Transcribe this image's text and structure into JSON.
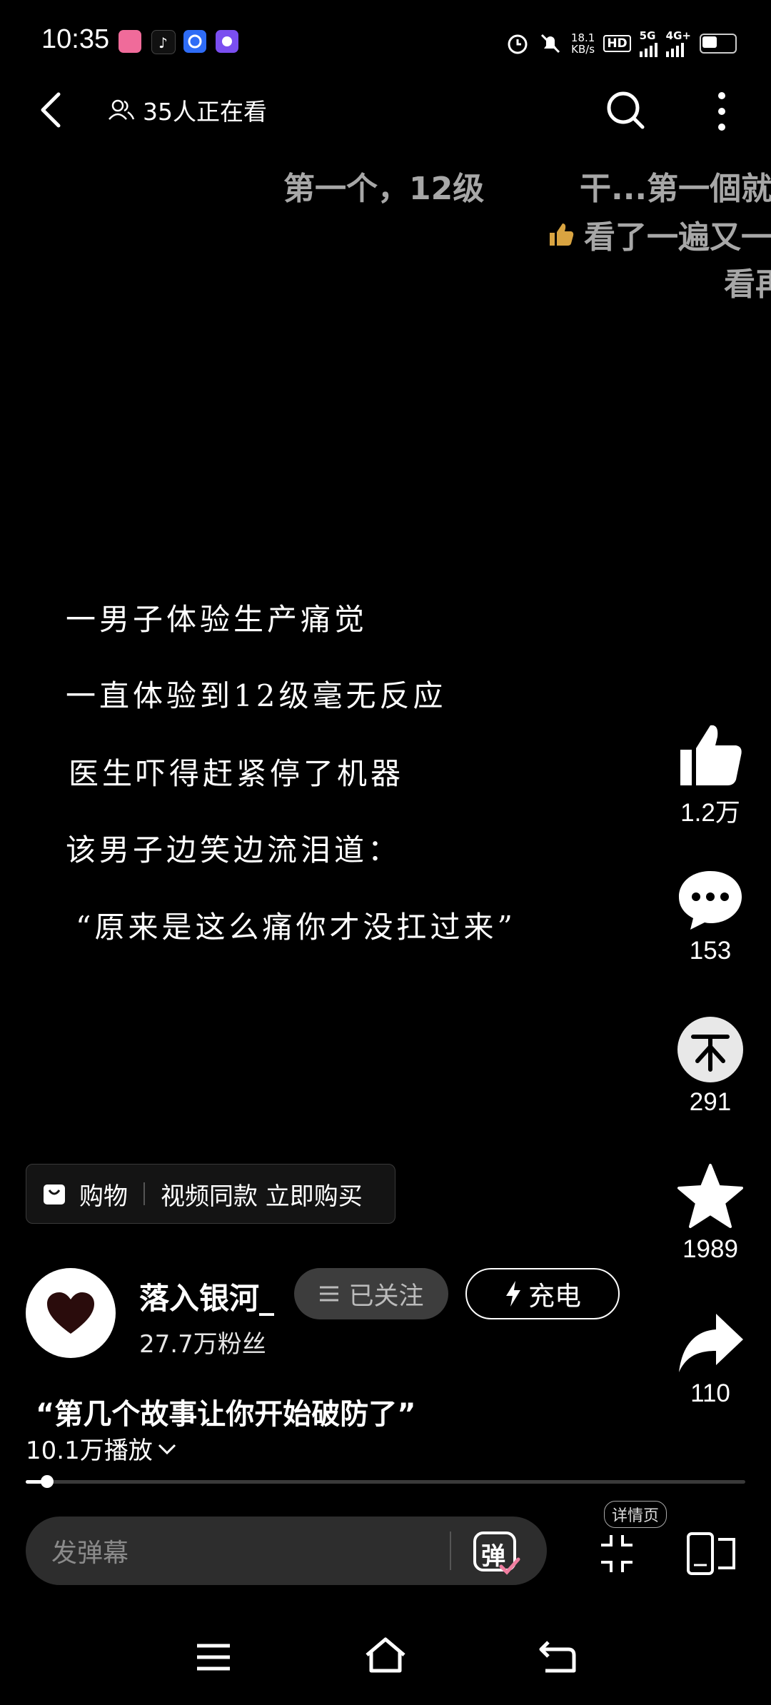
{
  "status_bar": {
    "time": "10:35",
    "net_speed_value": "18.1",
    "net_speed_unit": "KB/s",
    "hd": "HD",
    "network_1": "5G",
    "network_2": "4G+",
    "app_icons": [
      "bilibili-icon",
      "tiktok-icon",
      "browser-icon",
      "app-icon"
    ]
  },
  "top_bar": {
    "viewers_text": "35人正在看"
  },
  "danmaku": [
    "第一个，12级",
    "干...第一個就",
    "看了一遍又一",
    "看再"
  ],
  "subtitles": [
    "一男子体验生产痛觉",
    "一直体验到12级毫无反应",
    "医生吓得赶紧停了机器",
    "该男子边笑边流泪道：",
    "“原来是这么痛你才没扛过来”"
  ],
  "actions": {
    "like": "1.2万",
    "comment": "153",
    "coin": "291",
    "favorite": "1989",
    "share": "110"
  },
  "shop": {
    "label": "购物",
    "promo": "视频同款 立即购买"
  },
  "author": {
    "name": "落入银河_",
    "fans": "27.7万粉丝",
    "follow_label": "已关注",
    "charge_label": "充电"
  },
  "video": {
    "title": "“第几个故事让你开始破防了”",
    "plays": "10.1万播放",
    "progress": 0.03
  },
  "bottom": {
    "danmaku_placeholder": "发弹幕",
    "danmu_button": "弹",
    "detail_label": "详情页"
  },
  "colors": {
    "background": "#000000",
    "danmaku": "#a7a7a7",
    "coin_circle": "#e8e8e8",
    "followed_bg": "#3d3d3d"
  }
}
